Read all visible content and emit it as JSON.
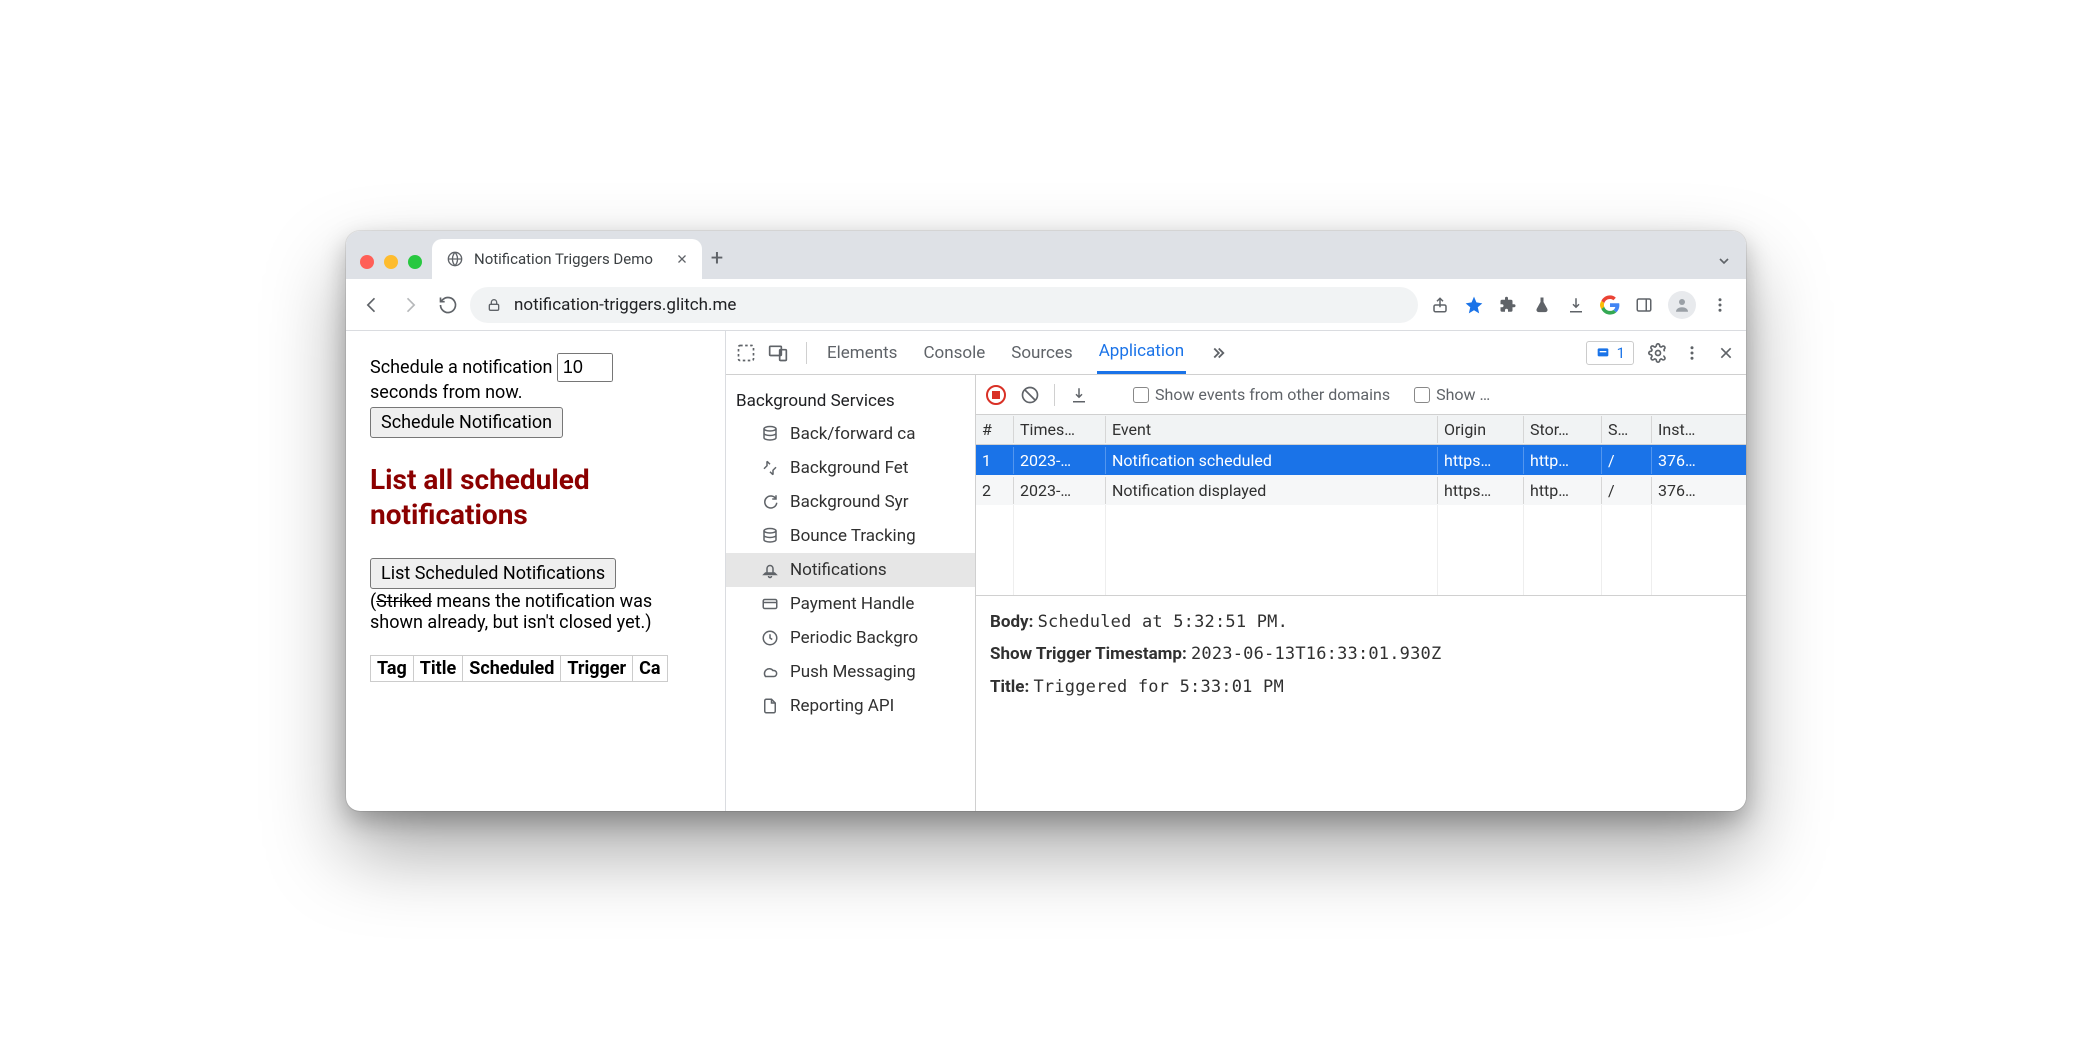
{
  "tab": {
    "title": "Notification Triggers Demo"
  },
  "url": {
    "host": "notification-triggers.glitch.me"
  },
  "page": {
    "schedule_text_a": "Schedule a notification ",
    "schedule_text_b": " seconds from now.",
    "seconds_value": "10",
    "schedule_btn": "Schedule Notification",
    "heading": "List all scheduled notifications",
    "list_btn": "List Scheduled Notifications",
    "hint_open": "(",
    "hint_strike": "Striked",
    "hint_rest": " means the notification was shown already, but isn't closed yet.)",
    "cols": {
      "tag": "Tag",
      "title": "Title",
      "scheduled": "Scheduled",
      "trigger": "Trigger",
      "cancel": "Ca"
    }
  },
  "devtools": {
    "tabs": {
      "elements": "Elements",
      "console": "Console",
      "sources": "Sources",
      "application": "Application"
    },
    "badge_count": "1",
    "toolbar": {
      "opt_other_domains": "Show events from other domains",
      "opt_show": "Show …"
    },
    "sidebar": {
      "header": "Background Services",
      "items": [
        "Back/forward ca",
        "Background Fet",
        "Background Syr",
        "Bounce Tracking",
        "Notifications",
        "Payment Handle",
        "Periodic Backgro",
        "Push Messaging",
        "Reporting API"
      ]
    },
    "grid": {
      "headers": {
        "idx": "#",
        "ts": "Times…",
        "event": "Event",
        "origin": "Origin",
        "storage": "Stor…",
        "sw": "S…",
        "inst": "Inst…"
      },
      "rows": [
        {
          "idx": "1",
          "ts": "2023-…",
          "event": "Notification scheduled",
          "origin": "https…",
          "storage": "http…",
          "sw": "/",
          "inst": "376…"
        },
        {
          "idx": "2",
          "ts": "2023-…",
          "event": "Notification displayed",
          "origin": "https…",
          "storage": "http…",
          "sw": "/",
          "inst": "376…"
        }
      ]
    },
    "details": {
      "body_label": "Body:",
      "body_value": "Scheduled at 5:32:51 PM.",
      "trigger_label": "Show Trigger Timestamp:",
      "trigger_value": "2023-06-13T16:33:01.930Z",
      "title_label": "Title:",
      "title_value": "Triggered for 5:33:01 PM"
    }
  }
}
